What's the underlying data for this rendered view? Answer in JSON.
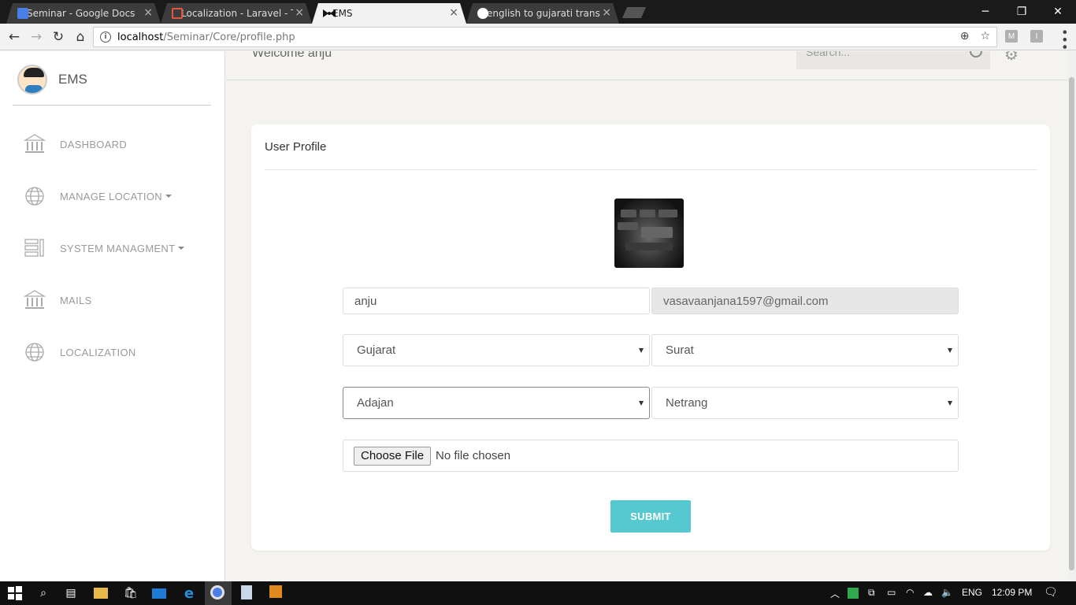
{
  "browser": {
    "tabs": [
      {
        "title": "Seminar - Google Docs",
        "icon": "google-docs-icon",
        "active": false
      },
      {
        "title": "Localization - Laravel - Th",
        "icon": "laravel-icon",
        "active": false
      },
      {
        "title": "EMS",
        "icon": "bowtie-icon",
        "active": true
      },
      {
        "title": "english to gujarati transla",
        "icon": "google-icon",
        "active": false
      }
    ],
    "url_host": "localhost",
    "url_path": "/Seminar/Core/profile.php",
    "extensions": [
      "M",
      "I"
    ]
  },
  "sidebar": {
    "brand": "EMS",
    "items": [
      {
        "label": "DASHBOARD",
        "icon": "bank-icon",
        "dropdown": false
      },
      {
        "label": "MANAGE LOCATION",
        "icon": "globe-icon",
        "dropdown": true
      },
      {
        "label": "SYSTEM MANAGMENT",
        "icon": "list-panel-icon",
        "dropdown": true
      },
      {
        "label": "MAILS",
        "icon": "bank-icon",
        "dropdown": false
      },
      {
        "label": "LOCALIZATION",
        "icon": "globe-icon",
        "dropdown": false
      }
    ]
  },
  "header": {
    "welcome": "Welcome anju",
    "search_placeholder": "Search..."
  },
  "profile": {
    "title": "User Profile",
    "name": "anju",
    "email": "vasavaanjana1597@gmail.com",
    "state": "Gujarat",
    "city": "Surat",
    "area": "Adajan",
    "taluka": "Netrang",
    "file_button": "Choose File",
    "file_status": "No file chosen",
    "submit": "SUBMIT"
  },
  "taskbar": {
    "language": "ENG",
    "time": "12:09 PM"
  },
  "colors": {
    "accent": "#56c8cf",
    "page_bg": "#f4f3ef"
  }
}
